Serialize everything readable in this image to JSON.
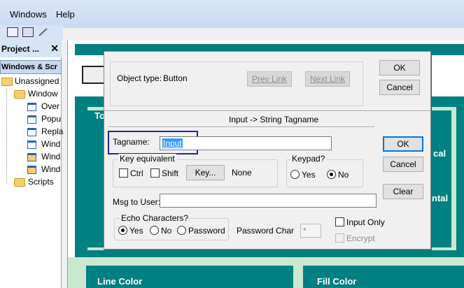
{
  "menu": {
    "windows": "Windows",
    "help": "Help"
  },
  "project_pane": {
    "title": "Project ...",
    "close": "✕",
    "section": "Windows & Scr",
    "tree": [
      {
        "label": "Unassigned",
        "icon": "folder-open-icon"
      },
      {
        "label": "Window",
        "icon": "folder-open-icon"
      },
      {
        "label": "Over",
        "icon": "window-icon"
      },
      {
        "label": "Popu",
        "icon": "window-icon"
      },
      {
        "label": "Repla",
        "icon": "window-icon"
      },
      {
        "label": "Wind",
        "icon": "window-icon"
      },
      {
        "label": "Wind",
        "icon": "window-yellow-icon"
      },
      {
        "label": "Wind",
        "icon": "window-yellow-icon"
      },
      {
        "label": "Scripts",
        "icon": "folder-icon"
      }
    ]
  },
  "editor": {
    "label_to": "To",
    "label_cal": "cal",
    "label_ntal": "ntal",
    "line_color": "Line Color",
    "fill_color": "Fill Color"
  },
  "dialog": {
    "object_type_label": "Object type:",
    "object_type_value": "Button",
    "prev_link": "Prev Link",
    "next_link": "Next Link",
    "ok_top": "OK",
    "cancel_top": "Cancel",
    "section_title": "Input -> String Tagname",
    "tagname_label": "Tagname:",
    "tagname_value": "Input",
    "ok": "OK",
    "cancel": "Cancel",
    "clear": "Clear",
    "key_equiv": {
      "title": "Key equivalent",
      "ctrl": "Ctrl",
      "shift": "Shift",
      "key_button": "Key...",
      "key_value": "None"
    },
    "keypad": {
      "title": "Keypad?",
      "yes": "Yes",
      "no": "No",
      "selected": "No"
    },
    "msg_to_user_label": "Msg to User:",
    "msg_to_user_value": "",
    "echo": {
      "title": "Echo Characters?",
      "yes": "Yes",
      "no": "No",
      "password": "Password",
      "selected": "Yes"
    },
    "password_char_label": "Password Char",
    "password_char_value": "*",
    "input_only": "Input Only",
    "encrypt": "Encrypt"
  },
  "colors": {
    "teal": "#008080",
    "menubar": "#d9e6f7",
    "highlight": "#1f2a8a",
    "selection": "#3399ff"
  }
}
